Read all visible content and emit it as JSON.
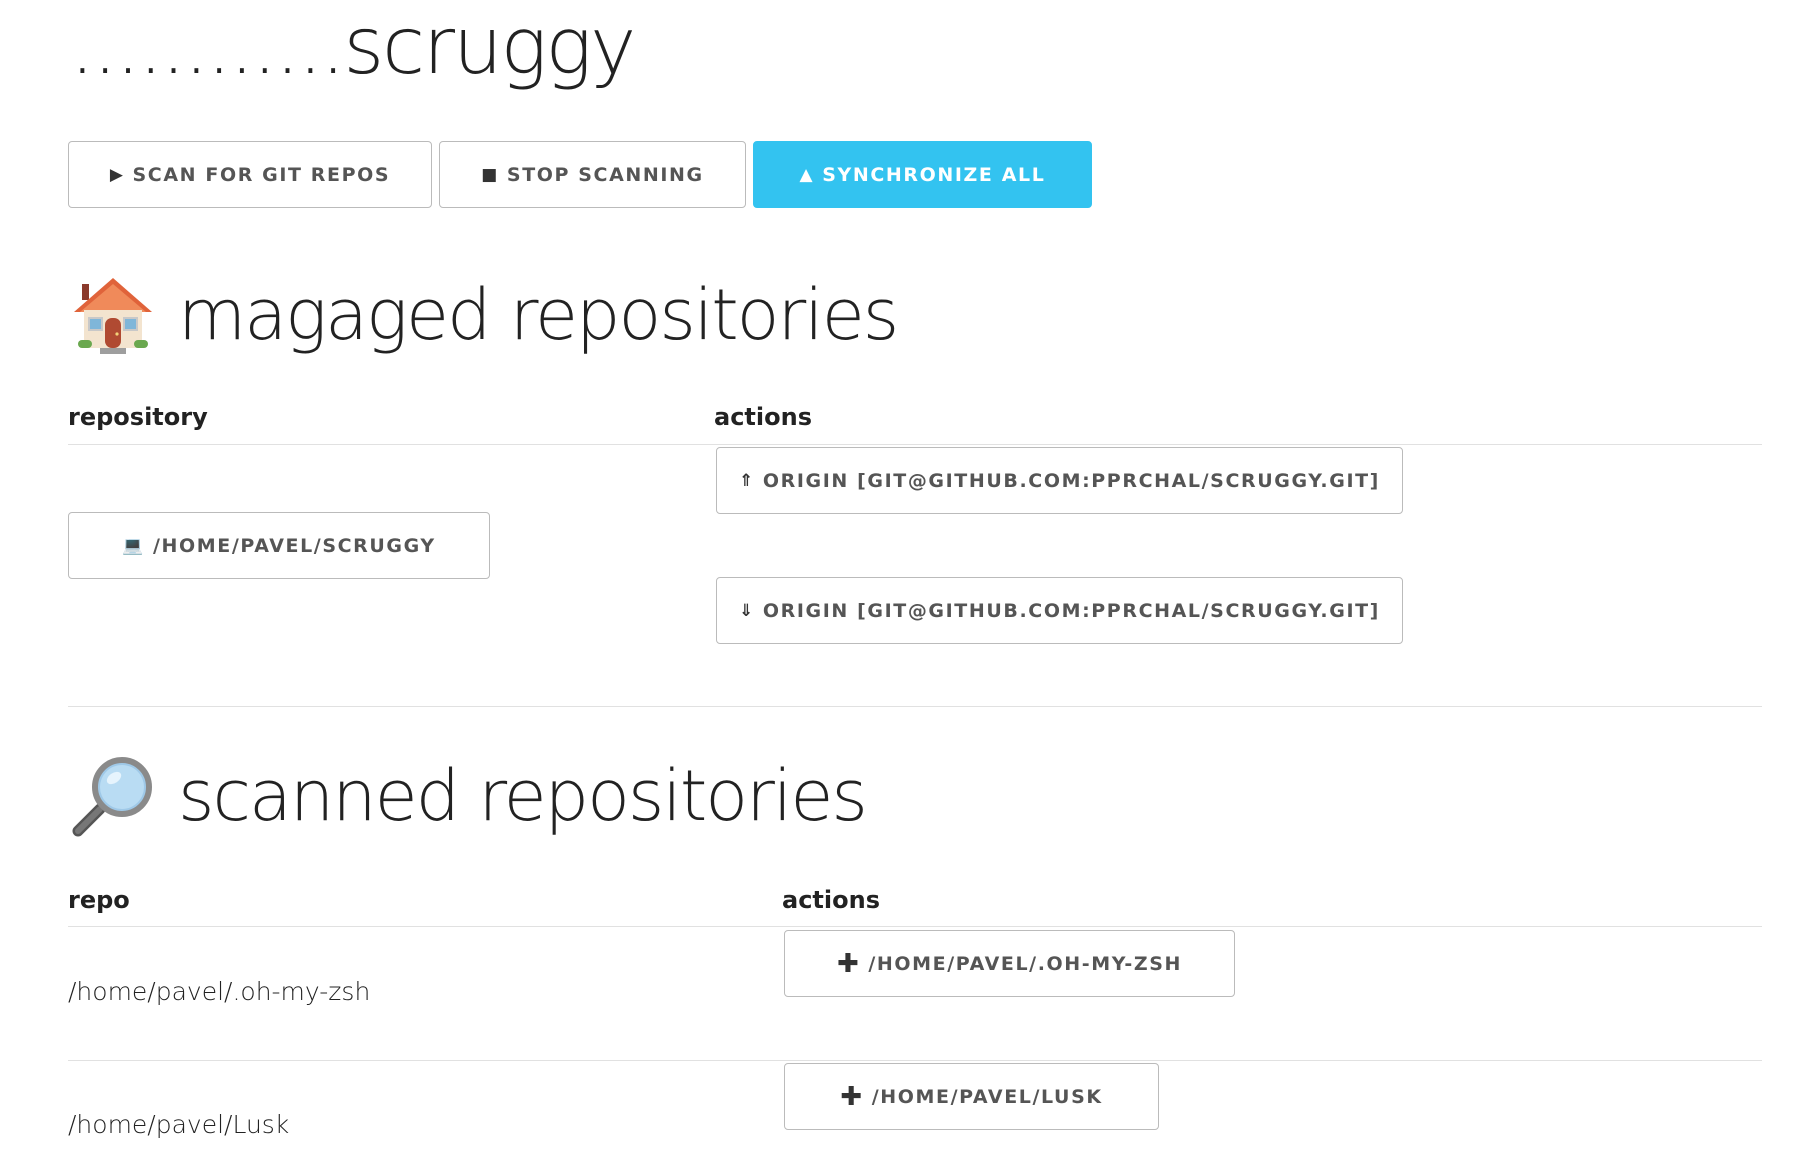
{
  "app": {
    "title": "............scruggy"
  },
  "toolbar": {
    "scan_label": "SCAN FOR GIT REPOS",
    "stop_label": "STOP SCANNING",
    "sync_label": "SYNCHRONIZE ALL"
  },
  "managed": {
    "title": "magaged repositories",
    "col_repository": "repository",
    "col_actions": "actions",
    "rows": [
      {
        "repo_label": "/HOME/PAVEL/SCRUGGY",
        "push_label": "ORIGIN [GIT@GITHUB.COM:PPRCHAL/SCRUGGY.GIT]",
        "pull_label": "ORIGIN [GIT@GITHUB.COM:PPRCHAL/SCRUGGY.GIT]"
      }
    ]
  },
  "scanned": {
    "title": "scanned repositories",
    "col_repo": "repo",
    "col_actions": "actions",
    "rows": [
      {
        "path": "/home/pavel/.oh-my-zsh",
        "add_label": "/HOME/PAVEL/.OH-MY-ZSH"
      },
      {
        "path": "/home/pavel/Lusk",
        "add_label": "/HOME/PAVEL/LUSK"
      }
    ]
  },
  "colors": {
    "primary": "#33c3f0",
    "border": "#bbbbbb",
    "rule": "#e1e1e1"
  },
  "icons": {
    "scan": "play-icon",
    "stop": "stop-icon",
    "sync": "up-triangle-icon",
    "managed_section": "house-icon",
    "scanned_section": "magnifier-icon",
    "repo": "laptop-icon",
    "push": "double-up-arrow-icon",
    "pull": "double-down-arrow-icon",
    "add": "plus-icon"
  }
}
